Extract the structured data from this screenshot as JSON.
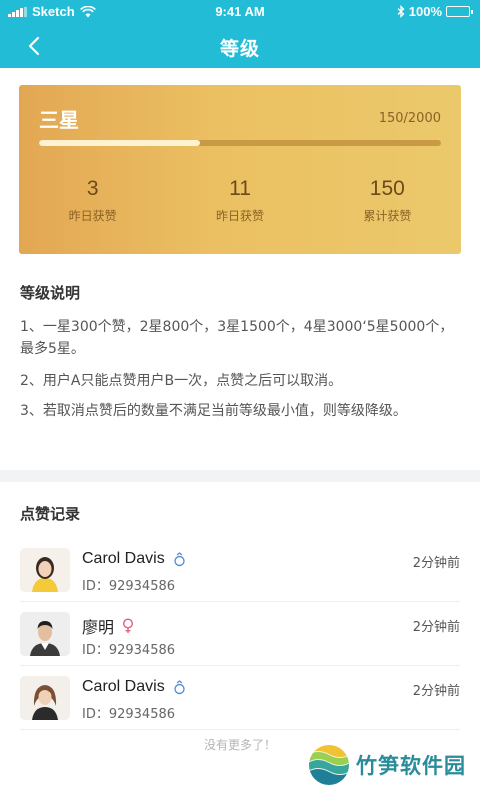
{
  "status_bar": {
    "carrier": "Sketch",
    "time": "9:41 AM",
    "battery": "100%"
  },
  "nav": {
    "title": "等级"
  },
  "level_card": {
    "level_name": "三星",
    "progress_text": "150/2000",
    "progress_fraction": 0.4,
    "stats": [
      {
        "value": "3",
        "label": "昨日获赞"
      },
      {
        "value": "11",
        "label": "昨日获赞"
      },
      {
        "value": "150",
        "label": "累计获赞"
      }
    ]
  },
  "explanation": {
    "title": "等级说明",
    "items": [
      "1、一星300个赞，2星800个，3星1500个，4星3000‘5星5000个，最多5星。",
      "2、用户A只能点赞用户B一次，点赞之后可以取消。",
      "3、若取消点赞后的数量不满足当前等级最小值，则等级降级。"
    ]
  },
  "records": {
    "title": "点赞记录",
    "items": [
      {
        "name": "Carol Davis",
        "gender": "male",
        "id": "ID：92934586",
        "time": "2分钟前"
      },
      {
        "name": "廖明",
        "gender": "female",
        "id": "ID：92934586",
        "time": "2分钟前"
      },
      {
        "name": "Carol Davis",
        "gender": "male",
        "id": "ID：92934586",
        "time": "2分钟前"
      }
    ],
    "no_more": "没有更多了！"
  },
  "watermark": {
    "text": "竹笋软件园"
  },
  "colors": {
    "accent": "#22bcd6",
    "card_gold": "#e8b75c",
    "male_icon": "#5b8fd6",
    "female_icon": "#e0607a"
  }
}
